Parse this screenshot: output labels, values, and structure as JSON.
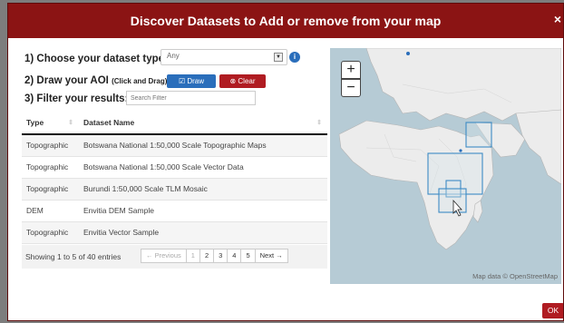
{
  "modal": {
    "title": "Discover Datasets to Add or remove from your map",
    "close": "×"
  },
  "steps": {
    "s1": "1) Choose your dataset type:",
    "s2": "2) Draw your AOI",
    "s2_note": "(Click and Drag)",
    "s3": "3) Filter your results:"
  },
  "dataset_type": {
    "value": "Any"
  },
  "info_icon": "i",
  "buttons": {
    "draw": "☑ Draw",
    "clear": "⊗ Clear",
    "ok": "OK"
  },
  "filter": {
    "placeholder": "Search Filter"
  },
  "table": {
    "headers": [
      "Type",
      "Dataset Name"
    ],
    "rows": [
      [
        "Topographic",
        "Botswana National 1:50,000 Scale Topographic Maps"
      ],
      [
        "Topographic",
        "Botswana National 1:50,000 Scale Vector Data"
      ],
      [
        "Topographic",
        "Burundi 1:50,000 Scale TLM Mosaic"
      ],
      [
        "DEM",
        "Envitia DEM Sample"
      ],
      [
        "Topographic",
        "Envitia Vector Sample"
      ]
    ]
  },
  "pagination": {
    "info": "Showing 1 to 5 of 40 entries",
    "previous": "← Previous",
    "pages": [
      "1",
      "2",
      "3",
      "4",
      "5"
    ],
    "next": "Next →"
  },
  "map": {
    "zoom_in": "+",
    "zoom_out": "−",
    "attribution": "Map data © OpenStreetMap"
  },
  "colors": {
    "header": "#8b1414",
    "primary": "#2a6ebb",
    "danger": "#b01c22",
    "water": "#b6cbd5",
    "land": "#ececec"
  }
}
